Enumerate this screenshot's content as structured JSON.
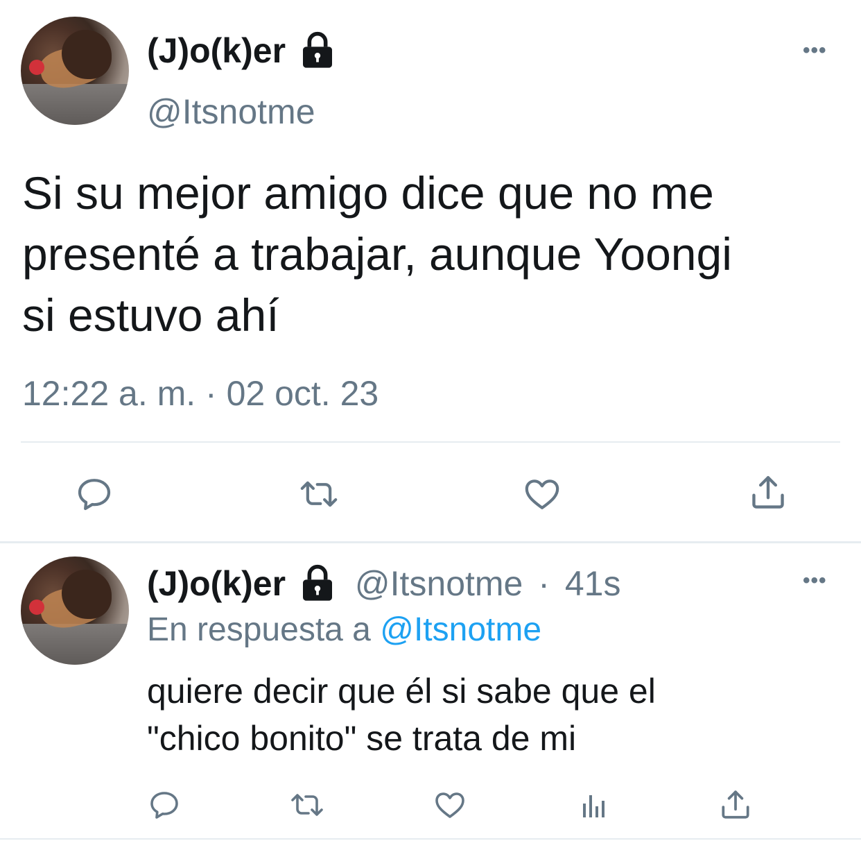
{
  "main_tweet": {
    "display_name": "(J)o(k)er",
    "handle": "@Itsnotme",
    "text_lines": [
      "Si su mejor amigo dice que no me",
      "presenté a trabajar, aunque Yoongi",
      "si estuvo ahí"
    ],
    "timestamp": "12:22 a. m. · 02 oct. 23",
    "actions": [
      "reply-icon",
      "retweet-icon",
      "like-icon",
      "share-icon"
    ]
  },
  "reply_tweet": {
    "display_name": "(J)o(k)er",
    "handle": "@Itsnotme",
    "separator": "·",
    "time_ago": "41s",
    "reply_prefix": "En respuesta a",
    "reply_mention": "@Itsnotme",
    "text_lines": [
      "quiere decir que él si sabe que el",
      "\"chico bonito\" se trata de mi"
    ],
    "actions": [
      "reply-icon",
      "retweet-icon",
      "like-icon",
      "analytics-icon",
      "share-icon"
    ]
  },
  "colors": {
    "text_primary": "#14171a",
    "text_secondary": "#657786",
    "accent": "#1da1f2",
    "divider": "#e6ecf0"
  }
}
